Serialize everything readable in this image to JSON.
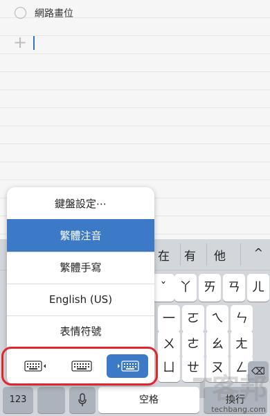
{
  "note": {
    "todo_text": "網路畫位",
    "add_symbol": "+"
  },
  "suggestions": {
    "items": [
      "在",
      "有",
      "他"
    ],
    "expand": "^"
  },
  "keyboard": {
    "row1_visible": [
      "ˇ",
      "丫",
      "ㄞ",
      "ㄢ",
      "ㄦ"
    ],
    "row2_visible": [
      "一",
      "ㄛ",
      "ㄟ",
      "ㄣ"
    ],
    "row3_visible": [
      "ㄨ",
      "ㄜ",
      "ㄠ",
      "ㄤ"
    ],
    "row4_visible": [
      "ㄩ",
      "ㄝ",
      "ㄡ",
      "ㄥ"
    ],
    "key_123": "123",
    "space_label": "空格",
    "return_label": "換行"
  },
  "input_menu": {
    "items": [
      "鍵盤設定⋯",
      "繁體注音",
      "繁體手寫",
      "English (US)",
      "表情符號"
    ],
    "selected_index": 1
  },
  "watermark": {
    "logo_text": "T客邦",
    "site": "techbang.com"
  },
  "colors": {
    "accent": "#3c7ac7",
    "highlight_ring": "#e2242c"
  }
}
